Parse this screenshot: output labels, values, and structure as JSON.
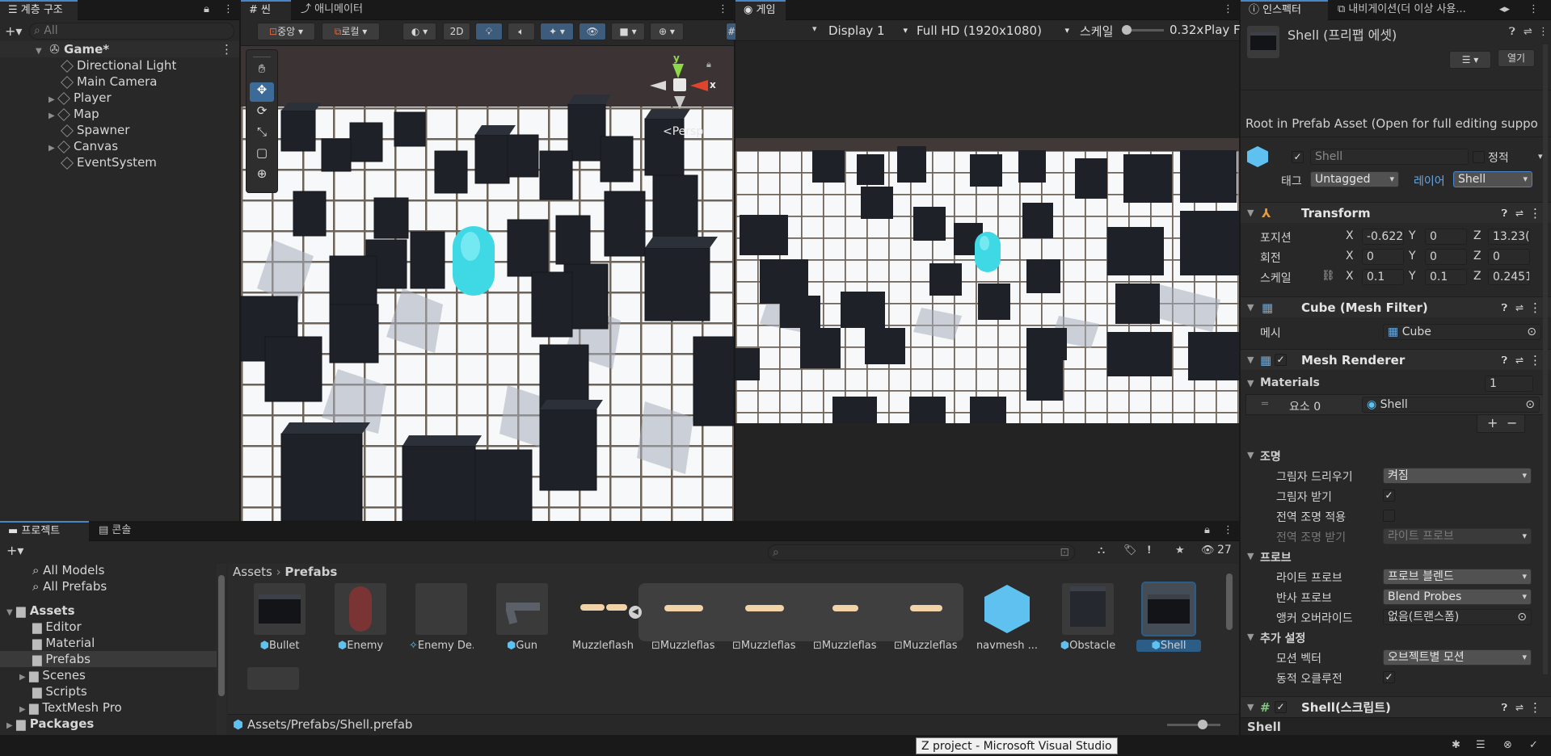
{
  "hierarchy": {
    "tab": "계층 구조",
    "search_placeholder": "All",
    "scene": "Game*",
    "items": [
      "Directional Light",
      "Main Camera",
      "Player",
      "Map",
      "Spawner",
      "Canvas",
      "EventSystem"
    ]
  },
  "scene_view": {
    "tab_scene": "씬",
    "tab_animator": "애니메이터",
    "pivot": "중앙",
    "space": "로컬",
    "mode_2d": "2D",
    "persp": "Persp",
    "gizmo_y": "y",
    "gizmo_x": "x"
  },
  "game_view": {
    "tab": "게임",
    "display": "Display 1",
    "resolution": "Full HD (1920x1080)",
    "scale_label": "스케일",
    "scale_value": "0.32x",
    "play_label": "Play F"
  },
  "inspector": {
    "tab_inspector": "인스펙터",
    "tab_navigation": "내비게이션(더 이상 사용...",
    "title": "Shell (프리팹 에셋)",
    "open_button": "열기",
    "root_info": "Root in Prefab Asset (Open for full editing suppo",
    "name_value": "Shell",
    "static_label": "정적",
    "tag_label": "태그",
    "tag_value": "Untagged",
    "layer_label": "레이어",
    "layer_value": "Shell",
    "transform": {
      "header": "Transform",
      "position_label": "포지션",
      "rotation_label": "회전",
      "scale_label": "스케일",
      "x": "X",
      "y": "Y",
      "z": "Z",
      "position": [
        "-0.622",
        "0",
        "13.23("
      ],
      "rotation": [
        "0",
        "0",
        "0"
      ],
      "scale": [
        "0.1",
        "0.1",
        "0.2451"
      ]
    },
    "mesh_filter": {
      "header": "Cube (Mesh Filter)",
      "mesh_label": "메시",
      "mesh_value": "Cube"
    },
    "mesh_renderer": {
      "header": "Mesh Renderer",
      "materials_label": "Materials",
      "materials_count": "1",
      "element_label": "요소 0",
      "element_value": "Shell",
      "plus": "+",
      "minus": "−"
    },
    "lighting": {
      "header": "조명",
      "cast_shadows_label": "그림자 드리우기",
      "cast_shadows_value": "켜짐",
      "receive_shadows_label": "그림자 받기",
      "contribute_gi_label": "전역 조명 적용",
      "receive_gi_label": "전역 조명 받기",
      "receive_gi_value": "라이트 프로브"
    },
    "probes": {
      "header": "프로브",
      "light_probes_label": "라이트 프로브",
      "light_probes_value": "프로브 블렌드",
      "reflection_probes_label": "반사 프로브",
      "reflection_probes_value": "Blend Probes",
      "anchor_label": "앵커 오버라이드",
      "anchor_value": "없음(트랜스폼)"
    },
    "additional": {
      "header": "추가 설정",
      "motion_vectors_label": "모션 벡터",
      "motion_vectors_value": "오브젝트별 모션",
      "dynamic_occlusion_label": "동적 오클루전"
    },
    "script_header": "Shell(스크립트)",
    "footer": "Shell"
  },
  "project": {
    "tab_project": "프로젝트",
    "tab_console": "콘솔",
    "hidden_count": "27",
    "favorites": [
      "All Models",
      "All Prefabs"
    ],
    "assets_root": "Assets",
    "folders": [
      "Editor",
      "Material",
      "Prefabs",
      "Scenes",
      "Scripts",
      "TextMesh Pro"
    ],
    "packages": "Packages",
    "breadcrumb_root": "Assets",
    "breadcrumb_current": "Prefabs",
    "items": [
      "Bullet",
      "Enemy",
      "Enemy De...",
      "Gun",
      "Muzzleflash",
      "Muzzleflas...",
      "Muzzleflas...",
      "Muzzleflas...",
      "Muzzleflas...",
      "navmesh ...",
      "Obstacle",
      "Shell"
    ],
    "path": "Assets/Prefabs/Shell.prefab"
  },
  "status": {
    "tooltip": "Z project - Microsoft Visual Studio"
  },
  "colors": {
    "accent": "#4a86c7",
    "selection": "#2c5d87",
    "cyan": "#3fd9e6",
    "prefab": "#5fc1f0"
  }
}
